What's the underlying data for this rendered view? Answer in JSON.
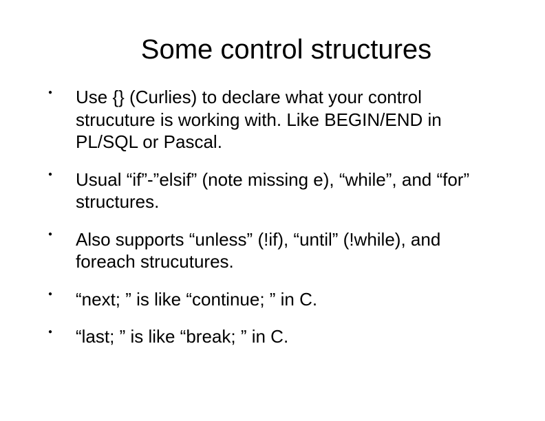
{
  "slide": {
    "title": "Some control structures",
    "bullets": [
      "Use {} (Curlies) to declare what your control strucuture is working with. Like BEGIN/END in PL/SQL or Pascal.",
      "Usual “if”-”elsif” (note missing e), “while”, and “for” structures.",
      "Also supports “unless” (!if), “until” (!while), and foreach strucutures.",
      "“next; ” is like “continue; ” in C.",
      "“last; ” is like “break; ” in C."
    ]
  }
}
